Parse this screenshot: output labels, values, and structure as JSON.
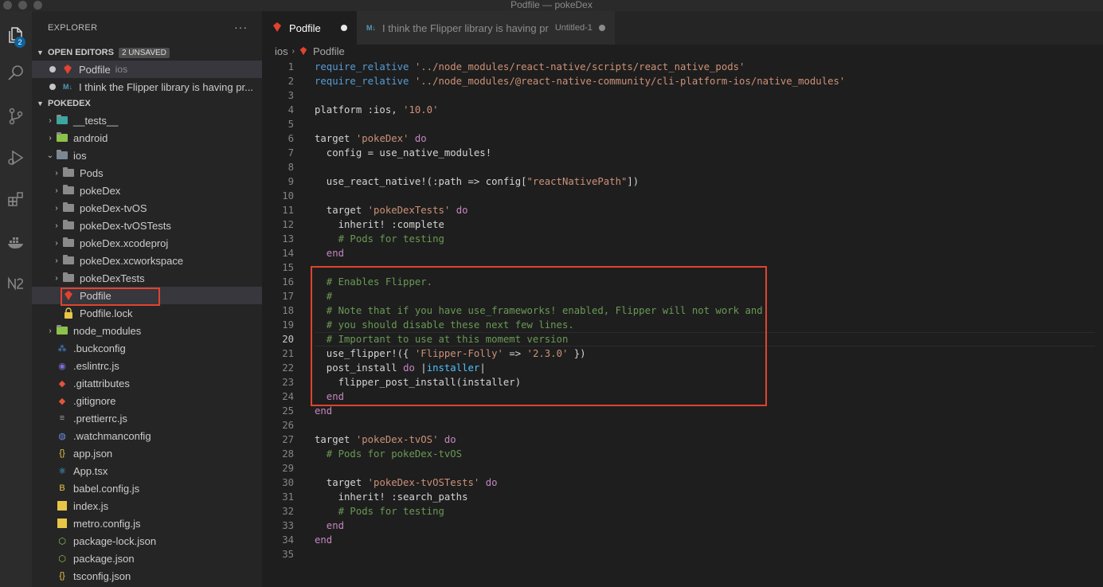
{
  "window": {
    "title": "Podfile — pokeDex"
  },
  "activity_bar": {
    "badge": "2",
    "items": [
      "explorer-icon",
      "search-icon",
      "source-control-icon",
      "run-debug-icon",
      "extensions-icon",
      "docker-icon",
      "nx-icon"
    ]
  },
  "sidebar": {
    "header": "EXPLORER",
    "more": "···",
    "open_editors": {
      "label": "OPEN EDITORS",
      "badge": "2 UNSAVED",
      "items": [
        {
          "name": "Podfile",
          "desc": "ios"
        },
        {
          "name": "I think the Flipper library is having pr..."
        }
      ]
    },
    "project": {
      "label": "POKEDEX",
      "items": [
        {
          "name": "__tests__"
        },
        {
          "name": "android"
        },
        {
          "name": "ios"
        },
        {
          "name": "Pods"
        },
        {
          "name": "pokeDex"
        },
        {
          "name": "pokeDex-tvOS"
        },
        {
          "name": "pokeDex-tvOSTests"
        },
        {
          "name": "pokeDex.xcodeproj"
        },
        {
          "name": "pokeDex.xcworkspace"
        },
        {
          "name": "pokeDexTests"
        },
        {
          "name": "Podfile"
        },
        {
          "name": "Podfile.lock"
        },
        {
          "name": "node_modules"
        },
        {
          "name": ".buckconfig"
        },
        {
          "name": ".eslintrc.js"
        },
        {
          "name": ".gitattributes"
        },
        {
          "name": ".gitignore"
        },
        {
          "name": ".prettierrc.js"
        },
        {
          "name": ".watchmanconfig"
        },
        {
          "name": "app.json"
        },
        {
          "name": "App.tsx"
        },
        {
          "name": "babel.config.js"
        },
        {
          "name": "index.js"
        },
        {
          "name": "metro.config.js"
        },
        {
          "name": "package-lock.json"
        },
        {
          "name": "package.json"
        },
        {
          "name": "tsconfig.json"
        }
      ]
    }
  },
  "tabs": [
    {
      "label": "Podfile"
    },
    {
      "label": "I think the Flipper library is having pr",
      "desc": "Untitled-1"
    }
  ],
  "breadcrumb": {
    "folder": "ios",
    "file": "Podfile"
  },
  "code": {
    "current_line": "20",
    "lines": [
      {
        "n": "1",
        "s": [
          [
            "fn2",
            "require_relative "
          ],
          [
            "str",
            "'../node_modules/react-native/scripts/react_native_pods'"
          ]
        ]
      },
      {
        "n": "2",
        "s": [
          [
            "fn2",
            "require_relative "
          ],
          [
            "str",
            "'../node_modules/@react-native-community/cli-platform-ios/native_modules'"
          ]
        ]
      },
      {
        "n": "3",
        "s": []
      },
      {
        "n": "4",
        "s": [
          [
            "sym",
            "platform :ios, "
          ],
          [
            "str",
            "'10.0'"
          ]
        ]
      },
      {
        "n": "5",
        "s": []
      },
      {
        "n": "6",
        "s": [
          [
            "sym",
            "target "
          ],
          [
            "str",
            "'pokeDex'"
          ],
          [
            "sym",
            " "
          ],
          [
            "kw",
            "do"
          ]
        ]
      },
      {
        "n": "7",
        "s": [
          [
            "sym",
            "  config = use_native_modules!"
          ]
        ]
      },
      {
        "n": "8",
        "s": []
      },
      {
        "n": "9",
        "s": [
          [
            "sym",
            "  use_react_native!(:path => config["
          ],
          [
            "str",
            "\"reactNativePath\""
          ],
          [
            "sym",
            "])"
          ]
        ]
      },
      {
        "n": "10",
        "s": []
      },
      {
        "n": "11",
        "s": [
          [
            "sym",
            "  target "
          ],
          [
            "str",
            "'pokeDexTests'"
          ],
          [
            "sym",
            " "
          ],
          [
            "kw",
            "do"
          ]
        ]
      },
      {
        "n": "12",
        "s": [
          [
            "sym",
            "    inherit! :complete"
          ]
        ]
      },
      {
        "n": "13",
        "s": [
          [
            "cmt",
            "    # Pods for testing"
          ]
        ]
      },
      {
        "n": "14",
        "s": [
          [
            "kw",
            "  end"
          ]
        ]
      },
      {
        "n": "15",
        "s": []
      },
      {
        "n": "16",
        "s": [
          [
            "cmt",
            "  # Enables Flipper."
          ]
        ]
      },
      {
        "n": "17",
        "s": [
          [
            "cmt",
            "  #"
          ]
        ]
      },
      {
        "n": "18",
        "s": [
          [
            "cmt",
            "  # Note that if you have use_frameworks! enabled, Flipper will not work and"
          ]
        ]
      },
      {
        "n": "19",
        "s": [
          [
            "cmt",
            "  # you should disable these next few lines."
          ]
        ]
      },
      {
        "n": "20",
        "s": [
          [
            "cmt",
            "  # Important to use at this momemt version"
          ]
        ]
      },
      {
        "n": "21",
        "s": [
          [
            "sym",
            "  use_flipper!({ "
          ],
          [
            "str",
            "'Flipper-Folly'"
          ],
          [
            "sym",
            " => "
          ],
          [
            "str",
            "'2.3.0'"
          ],
          [
            "sym",
            " })"
          ]
        ]
      },
      {
        "n": "22",
        "s": [
          [
            "sym",
            "  post_install "
          ],
          [
            "kw",
            "do"
          ],
          [
            "sym",
            " |"
          ],
          [
            "fn",
            "installer"
          ],
          [
            "sym",
            "|"
          ]
        ]
      },
      {
        "n": "23",
        "s": [
          [
            "sym",
            "    flipper_post_install(installer)"
          ]
        ]
      },
      {
        "n": "24",
        "s": [
          [
            "kw",
            "  end"
          ]
        ]
      },
      {
        "n": "25",
        "s": [
          [
            "kw",
            "end"
          ]
        ]
      },
      {
        "n": "26",
        "s": []
      },
      {
        "n": "27",
        "s": [
          [
            "sym",
            "target "
          ],
          [
            "str",
            "'pokeDex-tvOS'"
          ],
          [
            "sym",
            " "
          ],
          [
            "kw",
            "do"
          ]
        ]
      },
      {
        "n": "28",
        "s": [
          [
            "cmt",
            "  # Pods for pokeDex-tvOS"
          ]
        ]
      },
      {
        "n": "29",
        "s": []
      },
      {
        "n": "30",
        "s": [
          [
            "sym",
            "  target "
          ],
          [
            "str",
            "'pokeDex-tvOSTests'"
          ],
          [
            "sym",
            " "
          ],
          [
            "kw",
            "do"
          ]
        ]
      },
      {
        "n": "31",
        "s": [
          [
            "sym",
            "    inherit! :search_paths"
          ]
        ]
      },
      {
        "n": "32",
        "s": [
          [
            "cmt",
            "    # Pods for testing"
          ]
        ]
      },
      {
        "n": "33",
        "s": [
          [
            "kw",
            "  end"
          ]
        ]
      },
      {
        "n": "34",
        "s": [
          [
            "kw",
            "end"
          ]
        ]
      },
      {
        "n": "35",
        "s": []
      }
    ]
  }
}
